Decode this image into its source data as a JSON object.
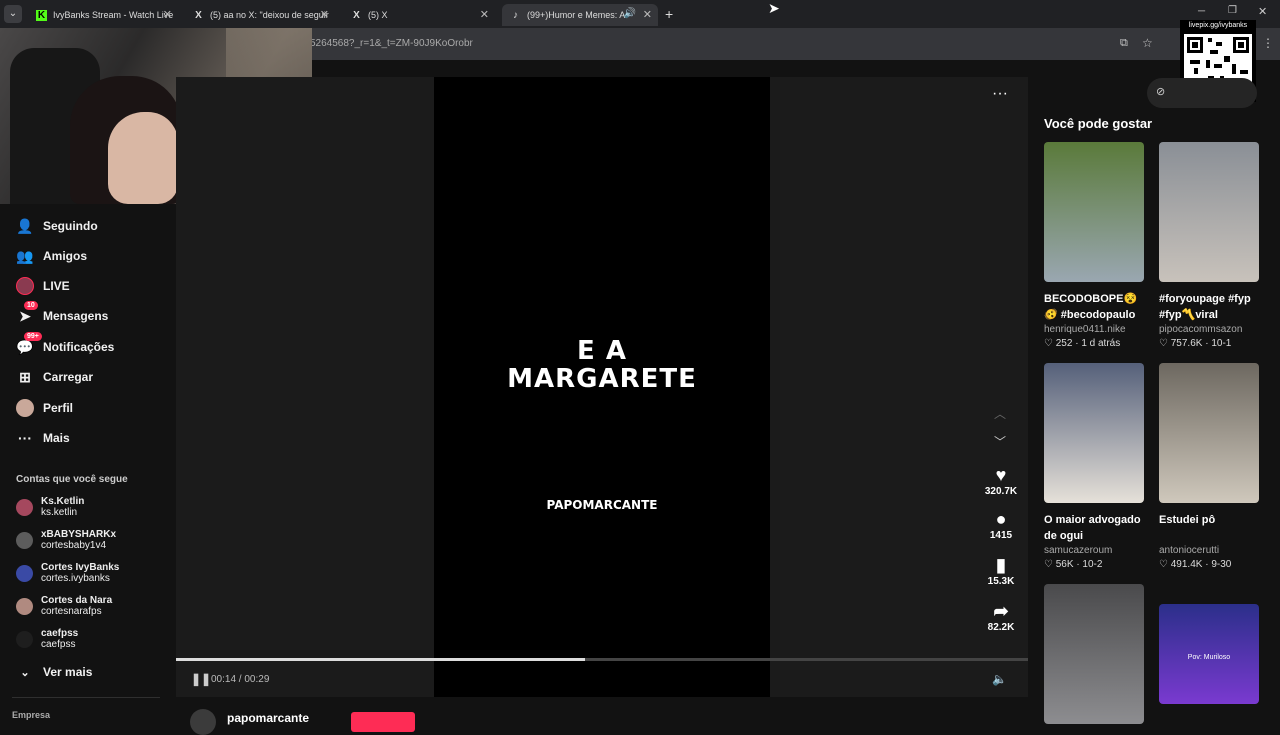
{
  "browser": {
    "tabs": [
      {
        "label": "IvyBanks Stream - Watch Live o",
        "icon": "K"
      },
      {
        "label": "(5) aa no X: \"deixou de seguir o",
        "icon": "X"
      },
      {
        "label": "(5) X",
        "icon": "X"
      },
      {
        "label": "(99+)Humor e Memes: A Tr",
        "icon": "tiktok"
      }
    ],
    "new_tab": "+",
    "url": "5264568?_r=1&_t=ZM-90J9KoOrobr"
  },
  "overlay": {
    "qr_label": "livepix.gg/ivybanks"
  },
  "sidebar": {
    "nav": [
      {
        "label": "Seguindo",
        "icon": "following-icon"
      },
      {
        "label": "Amigos",
        "icon": "friends-icon"
      },
      {
        "label": "LIVE",
        "icon": "live-icon"
      },
      {
        "label": "Mensagens",
        "icon": "messages-icon",
        "badge": "10"
      },
      {
        "label": "Notificações",
        "icon": "notifications-icon",
        "badge": "99+"
      },
      {
        "label": "Carregar",
        "icon": "upload-icon"
      },
      {
        "label": "Perfil",
        "icon": "profile-icon"
      },
      {
        "label": "Mais",
        "icon": "more-icon"
      }
    ],
    "following_heading": "Contas que você segue",
    "following": [
      {
        "name": "Ks.Ketlin",
        "handle": "ks.ketlin"
      },
      {
        "name": "xBABYSHARKx",
        "handle": "cortesbaby1v4"
      },
      {
        "name": "Cortes IvyBanks",
        "handle": "cortes.ivybanks"
      },
      {
        "name": "Cortes da Nara",
        "handle": "cortesnarafps"
      },
      {
        "name": "caefpss",
        "handle": "caefpss"
      }
    ],
    "see_more": "Ver mais",
    "footer": "Empresa"
  },
  "video": {
    "caption_line1": "E A",
    "caption_line2": "MARGARETE",
    "watermark": "PAPOMARCANTE",
    "time": "00:14 / 00:29",
    "progress": 0.48,
    "author": "papomarcante",
    "likes": "320.7K",
    "comments": "1415",
    "saves": "15.3K",
    "shares": "82.2K"
  },
  "recommendations": {
    "heading": "Você pode gostar",
    "items": [
      {
        "title": "BECODOBOPE😵🫨 #becodopaulo #au...",
        "author": "henrique0411.nike",
        "stats": "♡ 252 · 1 d atrás",
        "color1": "#5a7a3a",
        "color2": "#9aa7b1"
      },
      {
        "title": "#foryoupage #fyp #fyp〽️viral",
        "author": "pipocacommsazon",
        "stats": "♡ 757.6K · 10-1",
        "color1": "#8a8f96",
        "color2": "#c8c2bb"
      },
      {
        "title": "O maior advogado de ogui",
        "author": "samucazeroum",
        "stats": "♡ 56K · 10-2",
        "color1": "#55607a",
        "color2": "#e6e1d9"
      },
      {
        "title": "Estudei pô",
        "author": "antoniocerutti",
        "stats": "♡ 491.4K · 9-30",
        "color1": "#6d6860",
        "color2": "#cfc8bc"
      },
      {
        "title": "",
        "author": "",
        "stats": "",
        "color1": "#4a4a4c",
        "color2": "#8d8d90"
      },
      {
        "title": "",
        "author": "",
        "stats": "",
        "color1": "#2b2f8a",
        "color2": "#7a3ad0",
        "label": "Pov: Muriloso"
      }
    ]
  }
}
